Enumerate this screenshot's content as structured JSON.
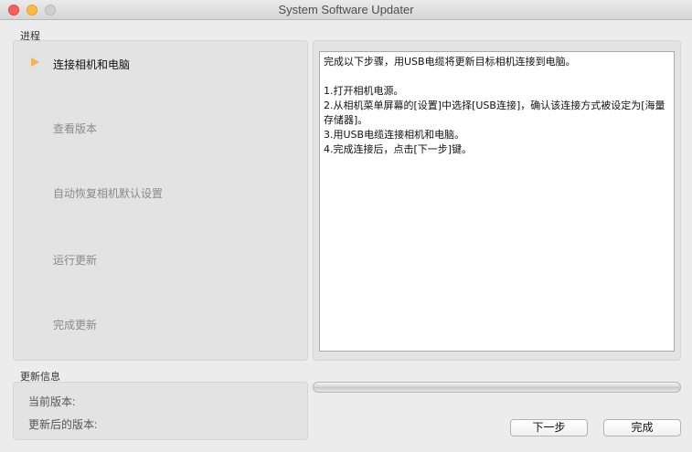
{
  "window": {
    "title": "System Software Updater"
  },
  "progress_section": {
    "label": "进程",
    "steps": [
      {
        "label": "连接相机和电脑",
        "active": true
      },
      {
        "label": "查看版本",
        "active": false
      },
      {
        "label": "自动恢复相机默认设置",
        "active": false
      },
      {
        "label": "运行更新",
        "active": false
      },
      {
        "label": "完成更新",
        "active": false
      }
    ]
  },
  "instructions": {
    "text": "完成以下步骤，用USB电缆将更新目标相机连接到电脑。\n\n1.打开相机电源。\n2.从相机菜单屏幕的[设置]中选择[USB连接]，确认该连接方式被设定为[海量存储器]。\n3.用USB电缆连接相机和电脑。\n4.完成连接后，点击[下一步]键。"
  },
  "update_info": {
    "label": "更新信息",
    "current_version_label": "当前版本:",
    "updated_version_label": "更新后的版本:"
  },
  "progress_bar": {
    "value": 0
  },
  "buttons": {
    "next_label": "下一步",
    "done_label": "完成"
  },
  "colors": {
    "active_step_arrow": "#f3b25a",
    "close": "#fc605c",
    "minimize": "#fdbc40"
  }
}
